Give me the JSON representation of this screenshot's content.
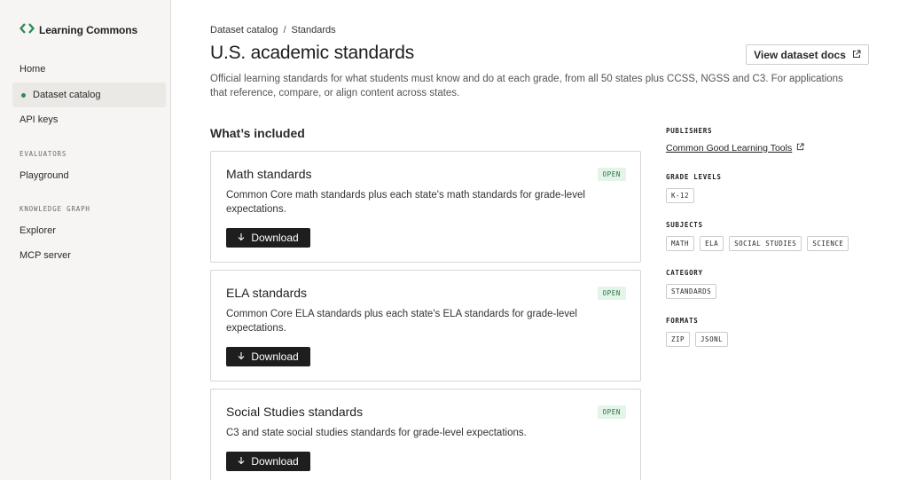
{
  "brand": {
    "name": "Learning Commons",
    "accent": "#2e8b57"
  },
  "sidebar": {
    "items": [
      {
        "label": "Home"
      },
      {
        "label": "Dataset catalog",
        "active": true
      },
      {
        "label": "API keys"
      }
    ],
    "sections": [
      {
        "title": "EVALUATORS",
        "items": [
          {
            "label": "Playground"
          }
        ]
      },
      {
        "title": "KNOWLEDGE GRAPH",
        "items": [
          {
            "label": "Explorer"
          },
          {
            "label": "MCP server"
          }
        ]
      }
    ]
  },
  "breadcrumb": {
    "parent": "Dataset catalog",
    "separator": "/",
    "current": "Standards"
  },
  "page": {
    "title": "U.S. academic standards",
    "docs_button": "View dataset docs",
    "description": "Official learning standards for what students must know and do at each grade, from all 50 states plus CCSS, NGSS and C3. For applications that reference, compare, or align content across states."
  },
  "included": {
    "heading": "What’s included",
    "cards": [
      {
        "title": "Math standards",
        "badge": "OPEN",
        "description": "Common Core math standards plus each state's math standards for grade-level expectations.",
        "button": "Download"
      },
      {
        "title": "ELA standards",
        "badge": "OPEN",
        "description": "Common Core ELA standards plus each state's ELA standards for grade-level expectations.",
        "button": "Download"
      },
      {
        "title": "Social Studies standards",
        "badge": "OPEN",
        "description": "C3 and state social studies standards for grade-level expectations.",
        "button": "Download"
      }
    ]
  },
  "meta": {
    "publishers": {
      "label": "PUBLISHERS",
      "value": "Common Good Learning Tools"
    },
    "grade_levels": {
      "label": "GRADE LEVELS",
      "chips": [
        "K-12"
      ]
    },
    "subjects": {
      "label": "SUBJECTS",
      "chips": [
        "MATH",
        "ELA",
        "SOCIAL STUDIES",
        "SCIENCE"
      ]
    },
    "category": {
      "label": "CATEGORY",
      "chips": [
        "STANDARDS"
      ]
    },
    "formats": {
      "label": "FORMATS",
      "chips": [
        "ZIP",
        "JSONL"
      ]
    }
  },
  "icons": {
    "brand": "code-brackets-icon",
    "external": "external-link-icon",
    "download": "arrow-down-icon"
  }
}
